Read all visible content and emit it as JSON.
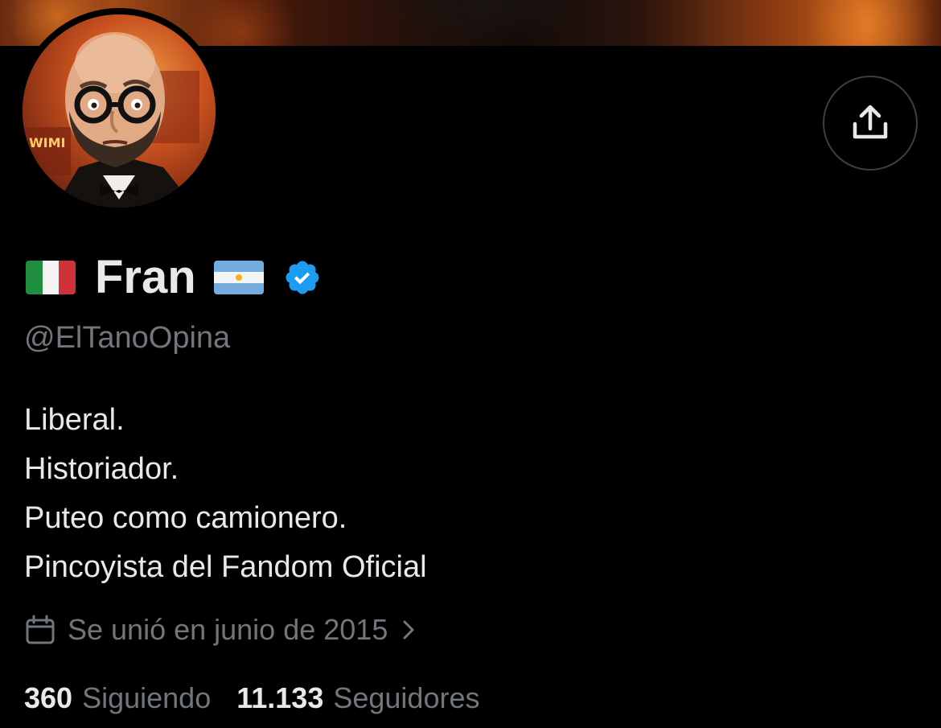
{
  "profile": {
    "display_name": "Fran",
    "handle": "@ElTanoOpina",
    "verified": true,
    "name_prefix_icon": "italy-flag-icon",
    "name_suffix_icon": "argentina-flag-icon",
    "bio_lines": [
      "Liberal.",
      "Historiador.",
      "Puteo como camionero.",
      "Pincoyista del Fandom Oficial"
    ],
    "joined": "Se unió en junio de 2015",
    "stats": {
      "following_count": "360",
      "following_label": "Siguiendo",
      "followers_count": "11.133",
      "followers_label": "Seguidores"
    }
  },
  "actions": {
    "share_icon": "share-upload-icon"
  },
  "colors": {
    "background": "#000000",
    "primary_text": "#e7e9ea",
    "secondary_text": "#71767b",
    "verified_blue": "#1d9bf0",
    "button_border": "#3b3f44"
  }
}
